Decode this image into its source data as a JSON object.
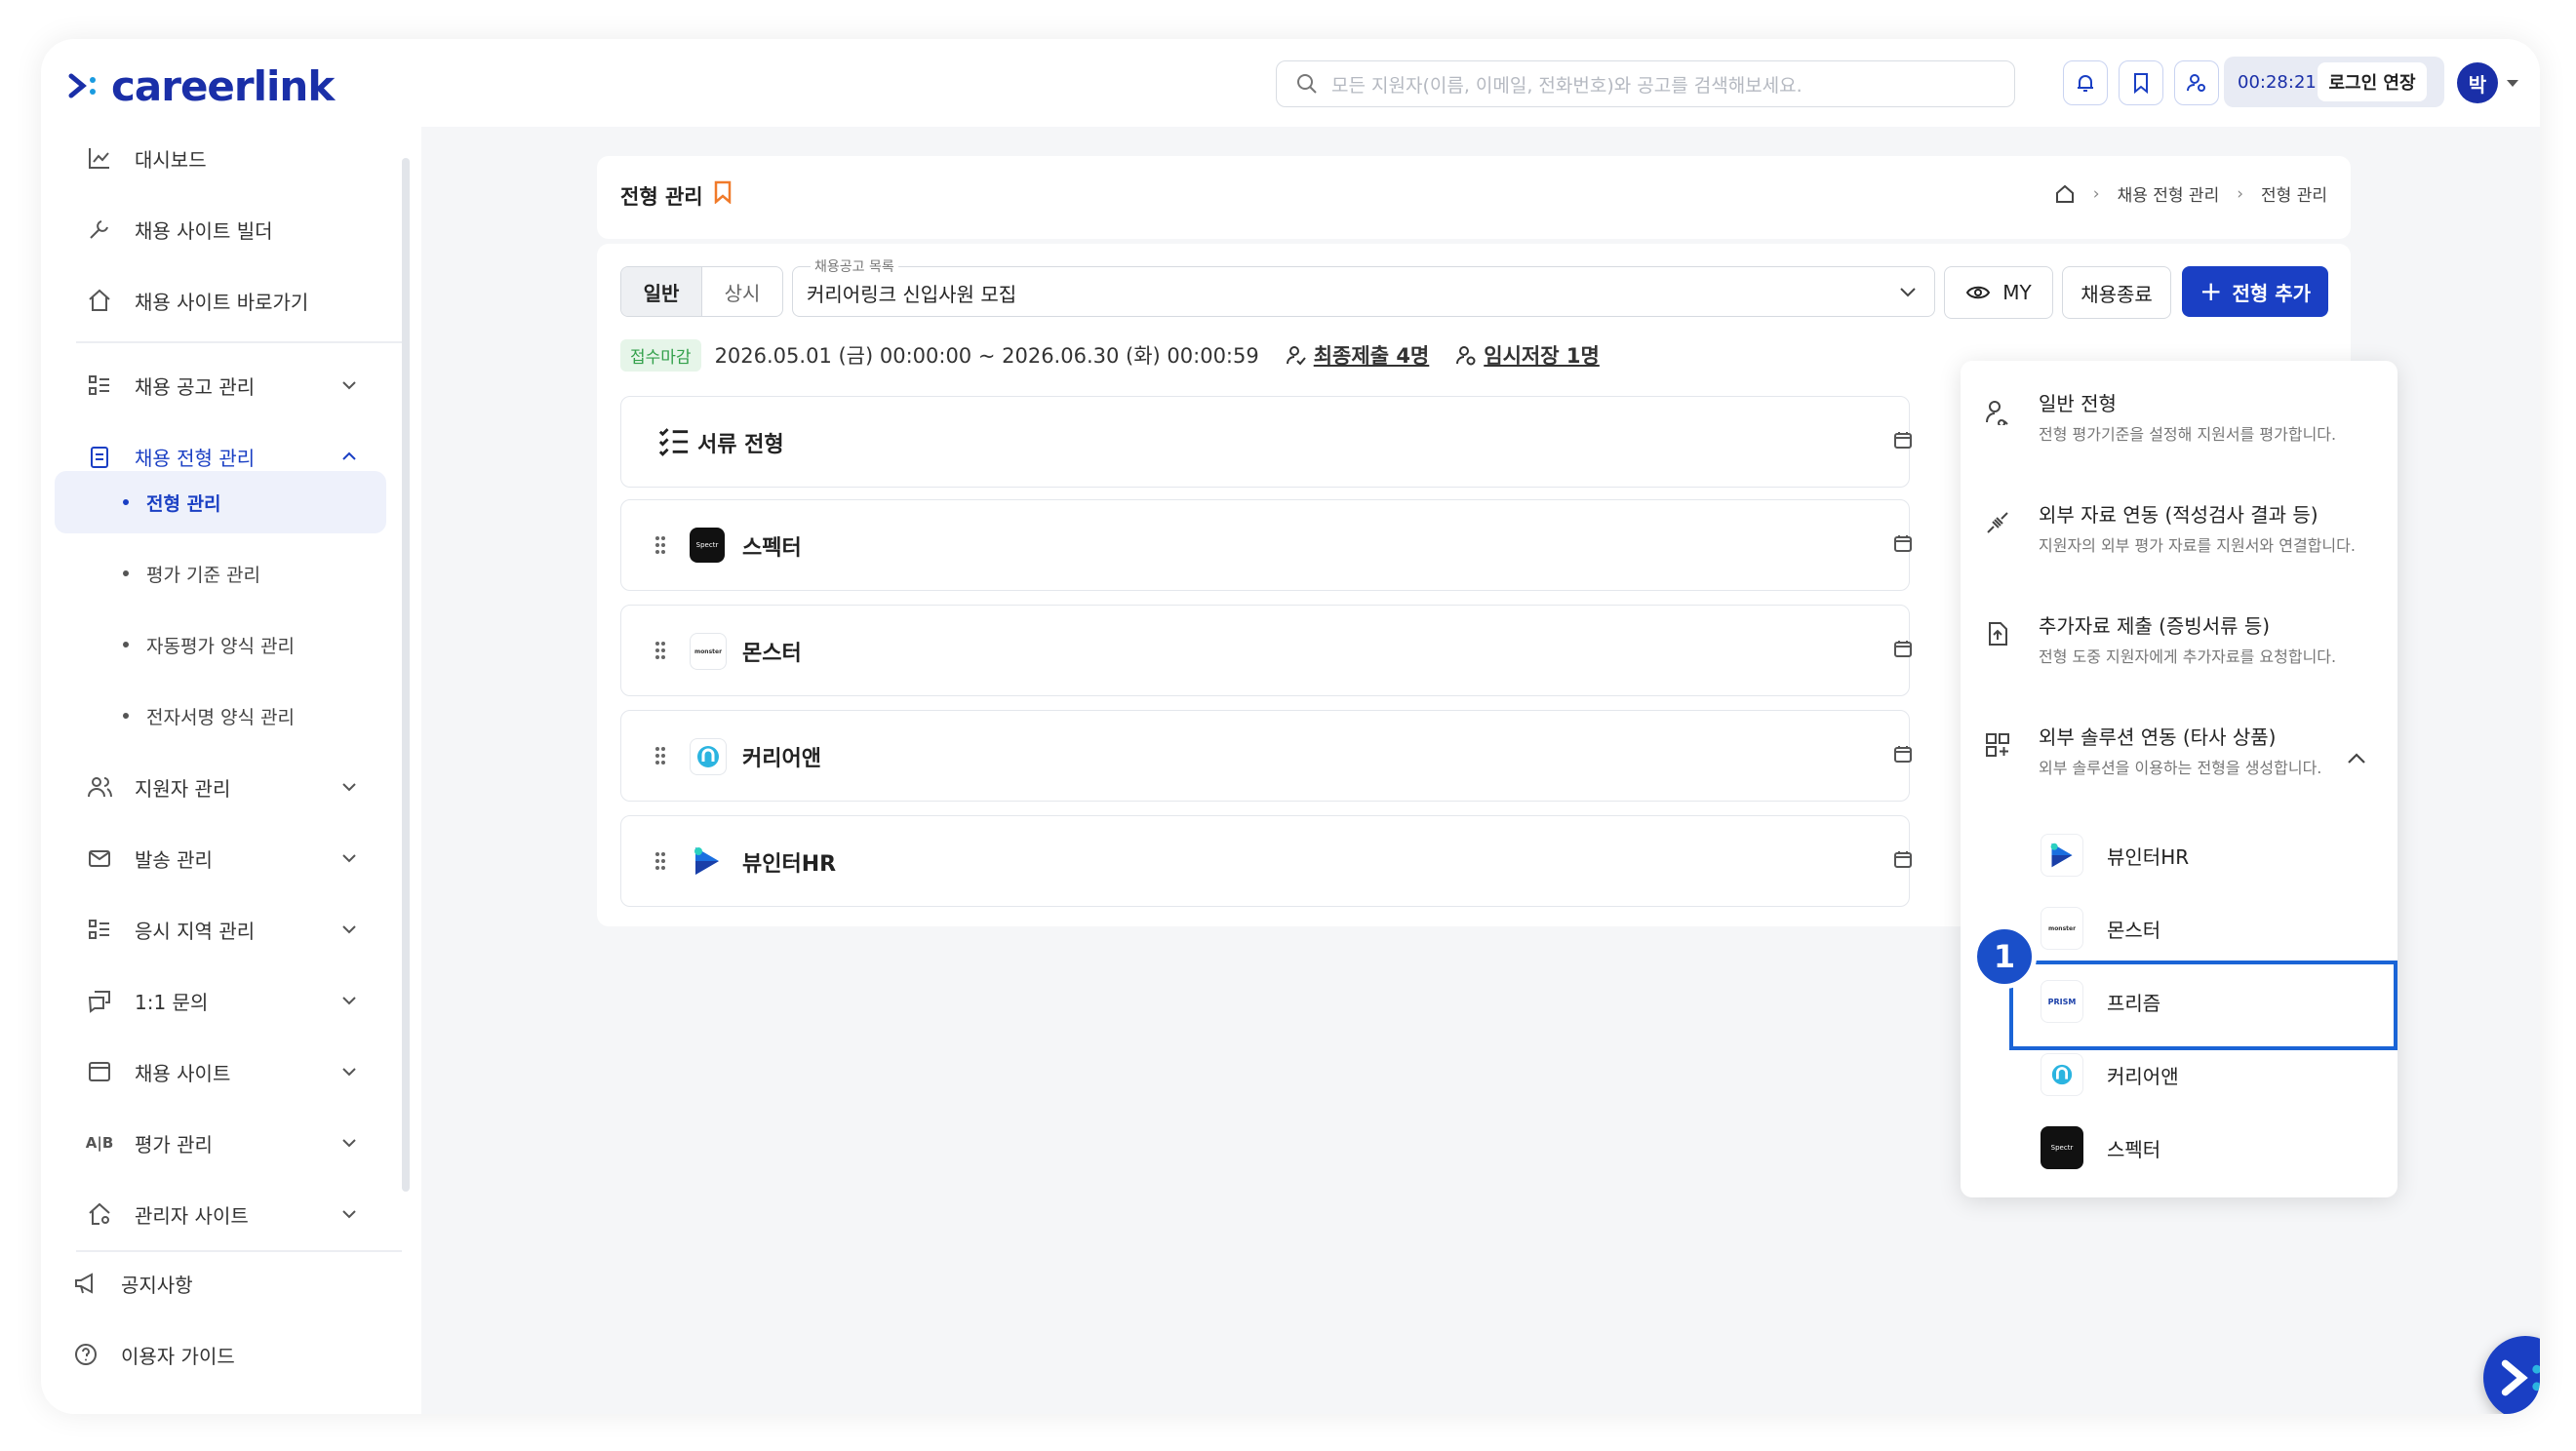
{
  "header": {
    "logo_text": "careerlink",
    "search_placeholder": "모든 지원자(이름, 이메일, 전화번호)와 공고를 검색해보세요.",
    "timer": "00:28:21",
    "extend_label": "로그인 연장",
    "avatar_initial": "박"
  },
  "sidebar": {
    "items": [
      {
        "label": "대시보드",
        "icon": "chart-icon"
      },
      {
        "label": "채용 사이트 빌더",
        "icon": "wrench-icon"
      },
      {
        "label": "채용 사이트 바로가기",
        "icon": "home-icon"
      },
      {
        "label": "채용 공고 관리",
        "icon": "list-icon"
      },
      {
        "label": "채용 전형 관리",
        "icon": "clipboard-icon",
        "active": true
      },
      {
        "label": "지원자 관리",
        "icon": "users-icon"
      },
      {
        "label": "발송 관리",
        "icon": "mail-icon"
      },
      {
        "label": "응시 지역 관리",
        "icon": "list-icon"
      },
      {
        "label": "1:1 문의",
        "icon": "chat-icon"
      },
      {
        "label": "채용 사이트",
        "icon": "window-icon"
      },
      {
        "label": "평가 관리",
        "icon": "ab-icon"
      },
      {
        "label": "관리자 사이트",
        "icon": "home-gear-icon"
      },
      {
        "label": "공지사항",
        "icon": "megaphone-icon"
      },
      {
        "label": "이용자 가이드",
        "icon": "help-icon"
      }
    ],
    "sub_items": [
      {
        "label": "전형 관리",
        "active": true
      },
      {
        "label": "평가 기준 관리"
      },
      {
        "label": "자동평가 양식 관리"
      },
      {
        "label": "전자서명 양식 관리"
      }
    ]
  },
  "page": {
    "title": "전형 관리",
    "breadcrumb": [
      "채용 전형 관리",
      "전형 관리"
    ]
  },
  "toolbar": {
    "tab_general": "일반",
    "tab_always": "상시",
    "select_label": "채용공고 목록",
    "select_value": "커리어링크 신입사원 모집",
    "my_label": "MY",
    "end_label": "채용종료",
    "add_label": "전형 추가"
  },
  "info": {
    "status": "접수마감",
    "period": "2026.05.01 (금) 00:00:00 ~ 2026.06.30 (화) 00:00:59",
    "final_submit": "최종제출 4명",
    "temp_save": "임시저장 1명"
  },
  "stages": [
    {
      "name": "서류 전형",
      "logo": "checklist-icon"
    },
    {
      "name": "스펙터",
      "logo": "specter-logo"
    },
    {
      "name": "몬스터",
      "logo": "monster-logo"
    },
    {
      "name": "커리어앤",
      "logo": "careerand-logo"
    },
    {
      "name": "뷰인터HR",
      "logo": "viewinter-logo"
    }
  ],
  "dropdown": {
    "options": [
      {
        "title": "일반 전형",
        "desc": "전형 평가기준을 설정해 지원서를 평가합니다."
      },
      {
        "title": "외부 자료 연동 (적성검사 결과 등)",
        "desc": "지원자의 외부 평가 자료를 지원서와 연결합니다."
      },
      {
        "title": "추가자료 제출 (증빙서류 등)",
        "desc": "전형 도중 지원자에게 추가자료를 요청합니다."
      },
      {
        "title": "외부 솔루션 연동 (타사 상품)",
        "desc": "외부 솔루션을 이용하는 전형을 생성합니다."
      }
    ],
    "solutions": [
      {
        "name": "뷰인터HR"
      },
      {
        "name": "몬스터"
      },
      {
        "name": "프리즘"
      },
      {
        "name": "커리어앤"
      },
      {
        "name": "스펙터"
      }
    ],
    "prism_logo_text": "PRISM",
    "monster_logo_text": "monster",
    "step_number": "1"
  },
  "colors": {
    "brand": "#1a3fc4",
    "highlight": "#1a64d6",
    "status_green": "#32a04a",
    "bookmark_orange": "#f07a2a"
  }
}
